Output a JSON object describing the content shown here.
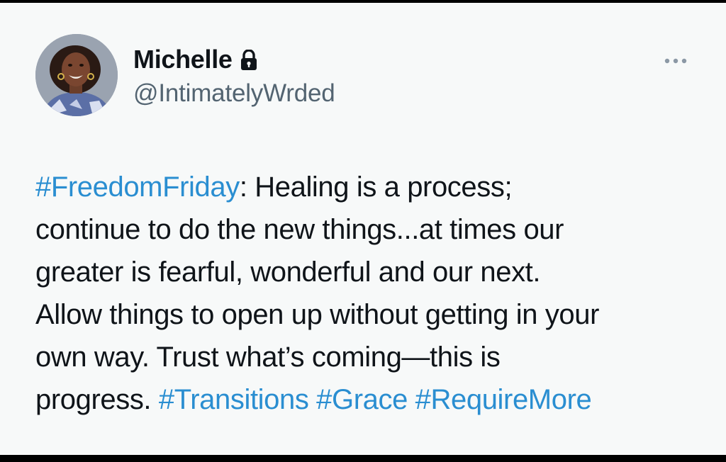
{
  "author": {
    "display_name": "Michelle",
    "handle": "@IntimatelyWrded",
    "protected_icon": "lock-icon",
    "avatar_icon": "profile-avatar"
  },
  "more_icon": "more-horizontal-icon",
  "tweet": {
    "hashtags": {
      "freedom_friday": "#FreedomFriday",
      "transitions": "#Transitions",
      "grace": "#Grace",
      "require_more": "#RequireMore"
    },
    "line1_rest": ": Healing is a process;",
    "line2": "continue to do the new things...at times our",
    "line3": "greater is fearful, wonderful and our next.",
    "line4": "Allow things to open up without getting in your",
    "line5": "own way. Trust what’s coming—this is",
    "line6_lead": "progress."
  },
  "colors": {
    "background": "#f7f9f9",
    "text": "#0f1419",
    "secondary_text": "#536471",
    "hashtag": "#2a8ed1",
    "frame": "#000000"
  }
}
